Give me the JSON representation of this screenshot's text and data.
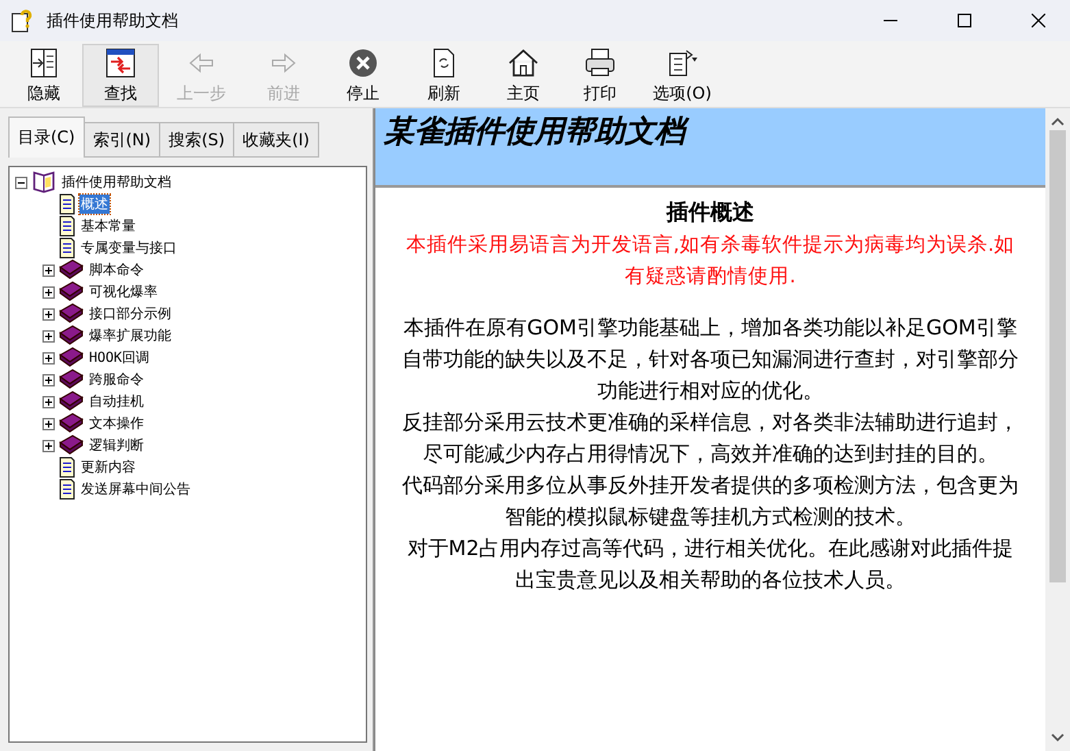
{
  "window": {
    "title": "插件使用帮助文档"
  },
  "toolbar": [
    {
      "label": "隐藏",
      "disabled": false,
      "pressed": false
    },
    {
      "label": "查找",
      "disabled": false,
      "pressed": true
    },
    {
      "label": "上一步",
      "disabled": true,
      "pressed": false
    },
    {
      "label": "前进",
      "disabled": true,
      "pressed": false
    },
    {
      "label": "停止",
      "disabled": false,
      "pressed": false
    },
    {
      "label": "刷新",
      "disabled": false,
      "pressed": false
    },
    {
      "label": "主页",
      "disabled": false,
      "pressed": false
    },
    {
      "label": "打印",
      "disabled": false,
      "pressed": false
    },
    {
      "label": "选项(O)",
      "disabled": false,
      "pressed": false
    }
  ],
  "tabs": [
    {
      "label": "目录(C)",
      "selected": true
    },
    {
      "label": "索引(N)",
      "selected": false
    },
    {
      "label": "搜索(S)",
      "selected": false
    },
    {
      "label": "收藏夹(I)",
      "selected": false
    }
  ],
  "tree": [
    {
      "label": "插件使用帮助文档",
      "kind": "book",
      "expanded": true,
      "selected": false,
      "children": [
        {
          "label": "概述",
          "kind": "page",
          "selected": true
        },
        {
          "label": "基本常量",
          "kind": "page",
          "selected": false
        },
        {
          "label": "专属变量与接口",
          "kind": "page",
          "selected": false
        },
        {
          "label": "脚本命令",
          "kind": "book",
          "expanded": false,
          "selected": false
        },
        {
          "label": "可视化爆率",
          "kind": "book",
          "expanded": false,
          "selected": false
        },
        {
          "label": "接口部分示例",
          "kind": "book",
          "expanded": false,
          "selected": false
        },
        {
          "label": "爆率扩展功能",
          "kind": "book",
          "expanded": false,
          "selected": false
        },
        {
          "label": "HOOK回调",
          "kind": "book",
          "expanded": false,
          "selected": false
        },
        {
          "label": "跨服命令",
          "kind": "book",
          "expanded": false,
          "selected": false
        },
        {
          "label": "自动挂机",
          "kind": "book",
          "expanded": false,
          "selected": false
        },
        {
          "label": "文本操作",
          "kind": "book",
          "expanded": false,
          "selected": false
        },
        {
          "label": "逻辑判断",
          "kind": "book",
          "expanded": false,
          "selected": false
        },
        {
          "label": "更新内容",
          "kind": "page",
          "selected": false
        },
        {
          "label": "发送屏幕中间公告",
          "kind": "page",
          "selected": false
        }
      ]
    }
  ],
  "document": {
    "banner": "某雀插件使用帮助文档",
    "heading": "插件概述",
    "paragraphs": [
      {
        "kind": "warning",
        "text": "本插件采用易语言为开发语言,如有杀毒软件提示为病毒均为误杀.如有疑惑请酌情使用."
      },
      {
        "kind": "body",
        "text": "本插件在原有GOM引擎功能基础上，增加各类功能以补足GOM引擎自带功能的缺失以及不足，针对各项已知漏洞进行查封，对引擎部分功能进行相对应的优化。"
      },
      {
        "kind": "body",
        "text": "反挂部分采用云技术更准确的采样信息，对各类非法辅助进行追封，尽可能减少内存占用得情况下，高效并准确的达到封挂的目的。"
      },
      {
        "kind": "body",
        "text": "代码部分采用多位从事反外挂开发者提供的多项检测方法，包含更为智能的模拟鼠标键盘等挂机方式检测的技术。"
      },
      {
        "kind": "body",
        "text": "对于M2占用内存过高等代码，进行相关优化。在此感谢对此插件提出宝贵意见以及相关帮助的各位技术人员。"
      }
    ]
  }
}
